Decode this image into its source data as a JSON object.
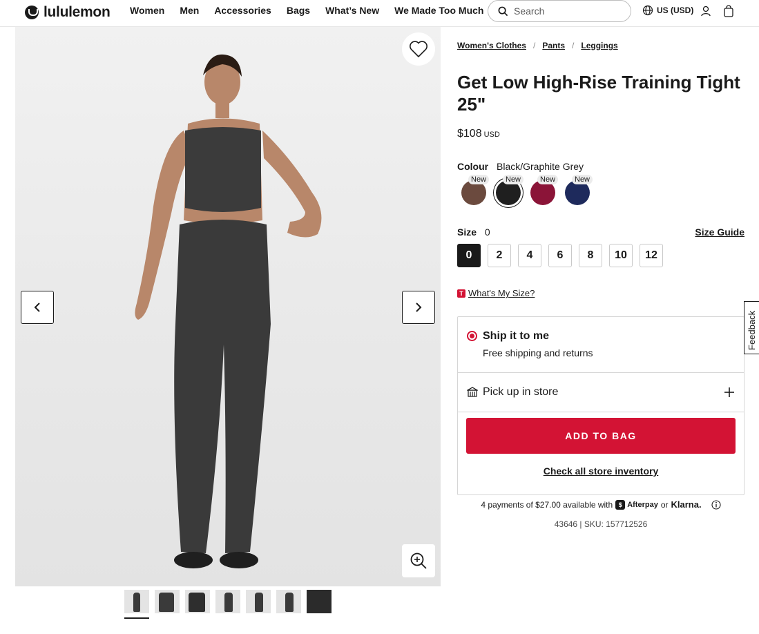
{
  "header": {
    "brand": "lululemon",
    "nav": [
      "Women",
      "Men",
      "Accessories",
      "Bags",
      "What’s New",
      "We Made Too Much"
    ],
    "search_placeholder": "Search",
    "locale": "US (USD)"
  },
  "gallery": {
    "thumbnail_count": 7,
    "active_thumbnail": 1
  },
  "product": {
    "breadcrumbs": [
      "Women's Clothes",
      "Pants",
      "Leggings"
    ],
    "title": "Get Low High-Rise Training Tight 25\"",
    "price": "$108",
    "currency": "USD",
    "colour_label": "Colour",
    "colour_value": "Black/Graphite Grey",
    "swatches": [
      {
        "badge": "New",
        "color": "#6b4a3e",
        "selected": false
      },
      {
        "badge": "New",
        "color": "#1f1f1f",
        "selected": true
      },
      {
        "badge": "New",
        "color": "#8b1438",
        "selected": false
      },
      {
        "badge": "New",
        "color": "#1e2a5c",
        "selected": false
      }
    ],
    "size_label": "Size",
    "size_value": "0",
    "size_guide": "Size Guide",
    "sizes": [
      "0",
      "2",
      "4",
      "6",
      "8",
      "10",
      "12"
    ],
    "selected_size": "0",
    "whats_my_size": "What's My Size?",
    "whats_my_size_badge": "T"
  },
  "fulfillment": {
    "ship_title": "Ship it to me",
    "ship_subtitle": "Free shipping and returns",
    "pickup_title": "Pick up in store",
    "add_to_bag": "ADD TO BAG",
    "inventory_link": "Check all store inventory"
  },
  "payments": {
    "prefix": "4 payments of $27.00 available with",
    "afterpay": "Afterpay",
    "or": "or",
    "klarna": "Klarna."
  },
  "sku_line": "43646 | SKU: 157712526",
  "feedback": "Feedback",
  "colors": {
    "accent_red": "#d31334",
    "text": "#1a1a1a"
  }
}
